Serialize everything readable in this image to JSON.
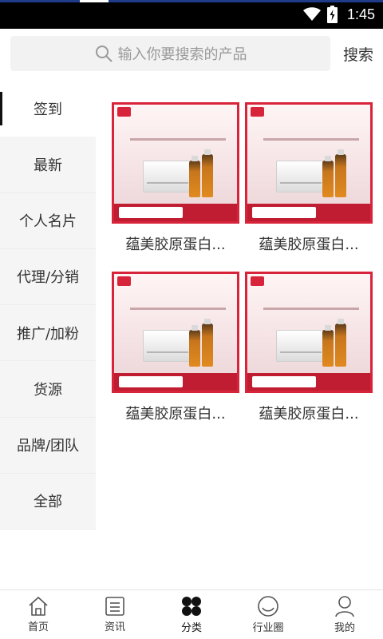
{
  "status_bar": {
    "time": "1:45"
  },
  "search": {
    "placeholder": "输入你要搜索的产品",
    "button_label": "搜索"
  },
  "sidebar": {
    "items": [
      {
        "label": "签到",
        "active": true
      },
      {
        "label": "最新"
      },
      {
        "label": "个人名片"
      },
      {
        "label": "代理/分销"
      },
      {
        "label": "推广/加粉"
      },
      {
        "label": "货源"
      },
      {
        "label": "品牌/团队"
      },
      {
        "label": "全部"
      }
    ]
  },
  "products": [
    {
      "name": "蕴美胶原蛋白..."
    },
    {
      "name": "蕴美胶原蛋白..."
    },
    {
      "name": "蕴美胶原蛋白..."
    },
    {
      "name": "蕴美胶原蛋白..."
    }
  ],
  "tabbar": {
    "items": [
      {
        "label": "首页",
        "icon": "home-icon"
      },
      {
        "label": "资讯",
        "icon": "news-icon"
      },
      {
        "label": "分类",
        "icon": "category-icon",
        "active": true
      },
      {
        "label": "行业圈",
        "icon": "circle-icon"
      },
      {
        "label": "我的",
        "icon": "profile-icon"
      }
    ]
  }
}
